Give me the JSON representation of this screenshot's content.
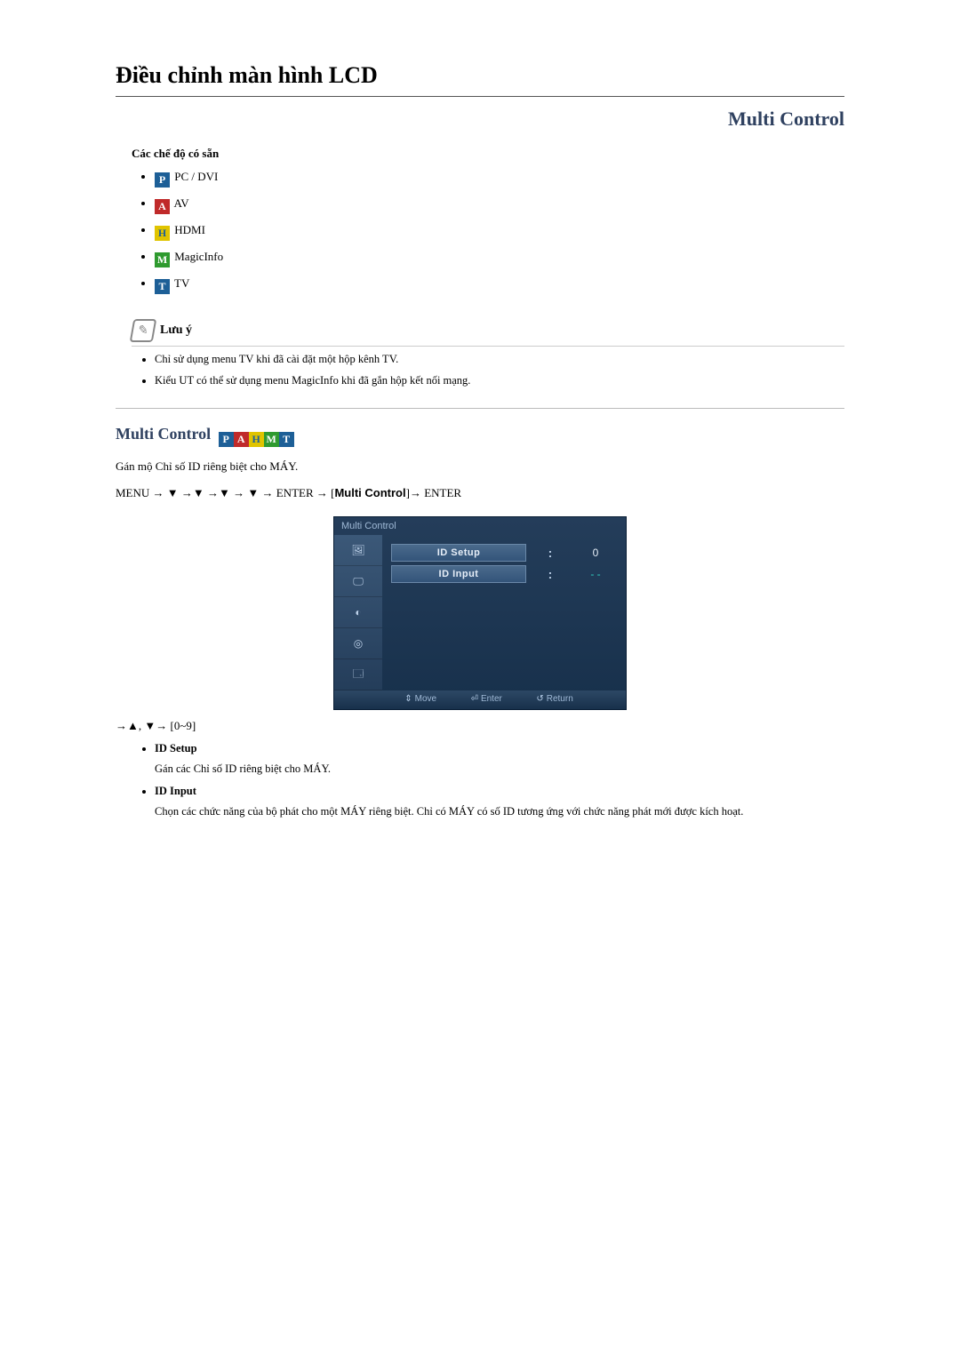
{
  "page": {
    "title": "Điều chỉnh màn hình LCD",
    "section_right": "Multi Control"
  },
  "modes": {
    "heading": "Các chế độ có sẵn",
    "items": [
      {
        "icon": "P",
        "label": "PC / DVI"
      },
      {
        "icon": "A",
        "label": "AV"
      },
      {
        "icon": "H",
        "label": "HDMI"
      },
      {
        "icon": "M",
        "label": "MagicInfo"
      },
      {
        "icon": "T",
        "label": "TV"
      }
    ]
  },
  "note": {
    "heading": "Lưu ý",
    "items": [
      "Chỉ sử dụng menu TV khi đã cài đặt một hộp kênh TV.",
      "Kiểu UT có thể sử dụng menu MagicInfo khi đã gắn hộp kết nối mạng."
    ]
  },
  "multi_control": {
    "heading": "Multi Control",
    "intro": "Gán mộ Chỉ số ID riêng biệt cho MÁY.",
    "nav_seq_prefix": "MENU → ▼ →▼ →▼ → ▼ → ENTER → [",
    "nav_seq_bold": "Multi Control",
    "nav_seq_suffix": "]→ ENTER",
    "after_osd": "→▲, ▼→ [0~9]"
  },
  "osd": {
    "title": "Multi Control",
    "rows": [
      {
        "label": "ID  Setup",
        "value": "0"
      },
      {
        "label": "ID  Input",
        "value": "- -"
      }
    ],
    "footer": [
      {
        "glyph": "⇕",
        "label": "Move"
      },
      {
        "glyph": "⏎",
        "label": "Enter"
      },
      {
        "glyph": "↺",
        "label": "Return"
      }
    ]
  },
  "definitions": [
    {
      "term": "ID Setup",
      "desc": "Gán các Chỉ số ID riêng biệt cho MÁY."
    },
    {
      "term": "ID Input",
      "desc": "Chọn các chức năng của bộ phát cho một MÁY riêng biệt. Chỉ có MÁY có số ID tương ứng với chức năng phát mới được kích hoạt."
    }
  ]
}
